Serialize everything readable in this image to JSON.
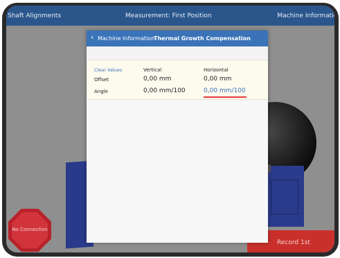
{
  "topbar": {
    "left": "Shaft Alignments",
    "center": "Measurement: First Position",
    "right": "Machine Information"
  },
  "background": {
    "stop_label": "No Connection",
    "record_label": "Record 1st"
  },
  "modal": {
    "back_label": "Machine Information",
    "title": "Thermal Growth Compensation",
    "clear_label": "Clear Values",
    "col_vertical": "Vertical",
    "col_horizontal": "Horizontal",
    "row_offset": "Offset",
    "row_angle": "Angle",
    "offset_vertical": "0,00 mm",
    "offset_horizontal": "0,00 mm",
    "angle_vertical": "0,00 mm/100",
    "angle_horizontal": "0,00 mm/100"
  },
  "colors": {
    "header_blue": "#3a73b8",
    "topbar_blue": "#2a568c",
    "stop_red": "#d2343c",
    "record_red": "#c9302c",
    "active_underline": "#e53a3a"
  },
  "icons": {
    "back": "chevron-left-icon"
  }
}
